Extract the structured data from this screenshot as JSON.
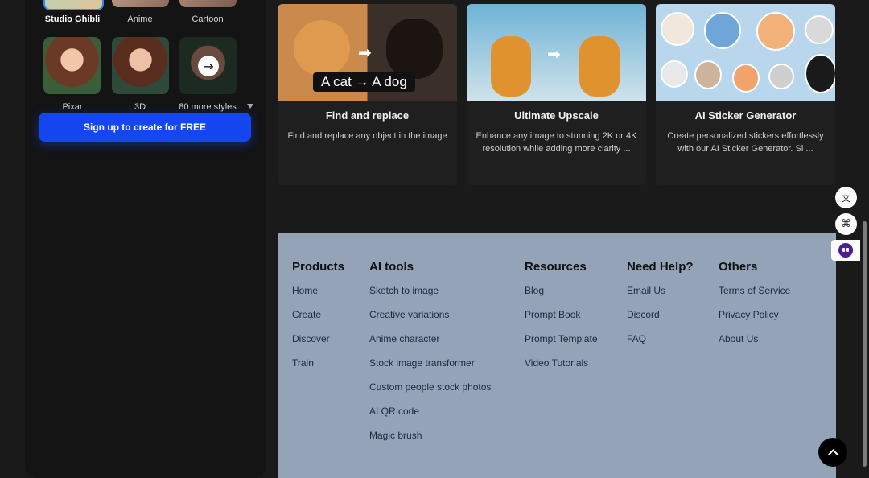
{
  "styles": {
    "row1": [
      "Studio Ghibli",
      "Anime",
      "Cartoon"
    ],
    "row2": [
      "Pixar",
      "3D",
      "80 more styles"
    ]
  },
  "signup_label": "Sign up to create for FREE",
  "cards": [
    {
      "title": "Find and replace",
      "desc": "Find and replace any object in the image",
      "overlay": "A cat → A dog"
    },
    {
      "title": "Ultimate Upscale",
      "desc": "Enhance any image to stunning 2K or 4K resolution while adding more clarity ..."
    },
    {
      "title": "AI Sticker Generator",
      "desc": "Create personalized stickers effortlessly with our AI Sticker Generator. Si ..."
    }
  ],
  "footer": {
    "products": {
      "title": "Products",
      "links": [
        "Home",
        "Create",
        "Discover",
        "Train"
      ]
    },
    "ai_tools": {
      "title": "AI tools",
      "links": [
        "Sketch to image",
        "Creative variations",
        "Anime character",
        "Stock image transformer",
        "Custom people stock photos",
        "AI QR code",
        "Magic brush"
      ]
    },
    "resources": {
      "title": "Resources",
      "links": [
        "Blog",
        "Prompt Book",
        "Prompt Template",
        "Video Tutorials"
      ]
    },
    "help": {
      "title": "Need Help?",
      "links": [
        "Email Us",
        "Discord",
        "FAQ"
      ]
    },
    "others": {
      "title": "Others",
      "links": [
        "Terms of Service",
        "Privacy Policy",
        "About Us"
      ]
    }
  },
  "colors": {
    "accent": "#1447f0",
    "footer_bg": "#94a3b8"
  }
}
